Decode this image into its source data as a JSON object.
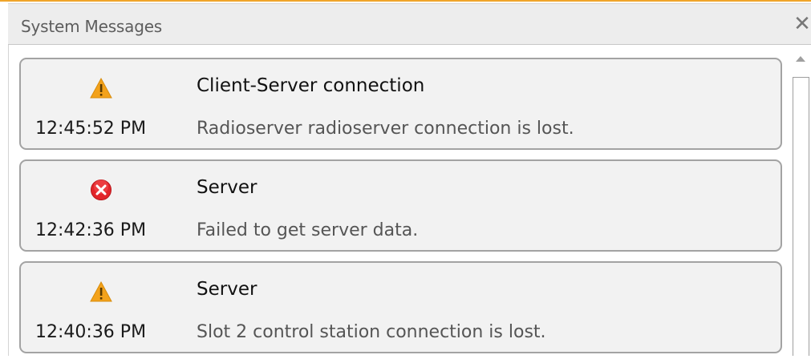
{
  "panel": {
    "title": "System Messages",
    "close_symbol": "✕"
  },
  "messages": [
    {
      "severity": "warning",
      "icon": "warning-icon",
      "title": "Client-Server connection",
      "time": "12:45:52 PM",
      "text": "Radioserver radioserver connection is lost."
    },
    {
      "severity": "error",
      "icon": "error-icon",
      "title": "Server",
      "time": "12:42:36 PM",
      "text": "Failed to get server data."
    },
    {
      "severity": "warning",
      "icon": "warning-icon",
      "title": "Server",
      "time": "12:40:36 PM",
      "text": "Slot 2 control station connection is lost."
    }
  ],
  "colors": {
    "accent": "#f0a52a",
    "warning": "#f3a21b",
    "error": "#e2242a"
  }
}
